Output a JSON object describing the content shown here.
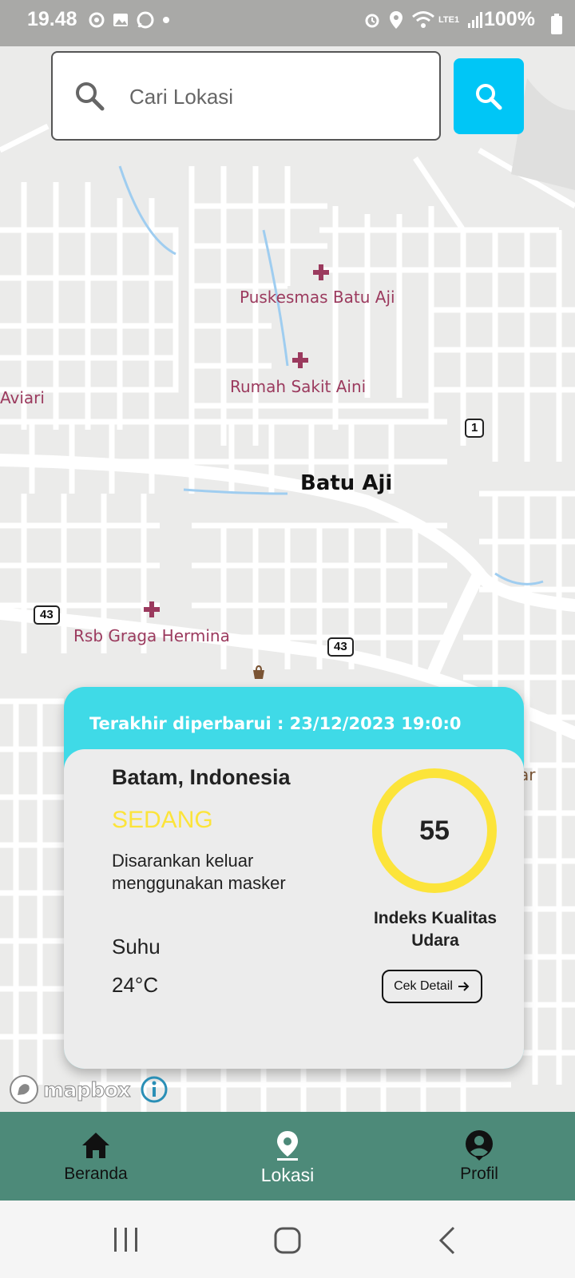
{
  "status_bar": {
    "time": "19.48",
    "battery": "100%",
    "network": "LTE1",
    "left_icons": [
      "sync-icon",
      "gallery-icon",
      "whatsapp-icon",
      "dot-icon"
    ],
    "right_icons": [
      "alarm-icon",
      "location-icon",
      "wifi-icon",
      "signal-icon",
      "battery-icon"
    ]
  },
  "search": {
    "placeholder": "Cari Lokasi",
    "value": ""
  },
  "map": {
    "places": {
      "puskesmas": "Puskesmas Batu Aji",
      "rumah_sakit": "Rumah Sakit Aini",
      "rsb": "Rsb Graga Hermina",
      "aviari": "Aviari",
      "area": "Batu Aji",
      "partial_right": "ar"
    },
    "road_shields": [
      "1",
      "43",
      "43"
    ],
    "attribution": "mapbox",
    "info": "i"
  },
  "card": {
    "last_updated": "Terakhir diperbarui : 23/12/2023 19:0:0",
    "city": "Batam, Indonesia",
    "level": "SEDANG",
    "level_color": "#fce43a",
    "advice": "Disarankan keluar menggunakan masker",
    "temp_label": "Suhu",
    "temp_value": "24°C",
    "aqi": "55",
    "aqi_label": "Indeks Kualitas Udara",
    "detail_button": "Cek Detail",
    "accent": "#3fdae7"
  },
  "bottom_nav": {
    "items": [
      {
        "label": "Beranda",
        "icon": "home-icon"
      },
      {
        "label": "Lokasi",
        "icon": "location-pin-icon",
        "active": true
      },
      {
        "label": "Profil",
        "icon": "profile-icon"
      }
    ],
    "bg": "#4d8a79"
  }
}
